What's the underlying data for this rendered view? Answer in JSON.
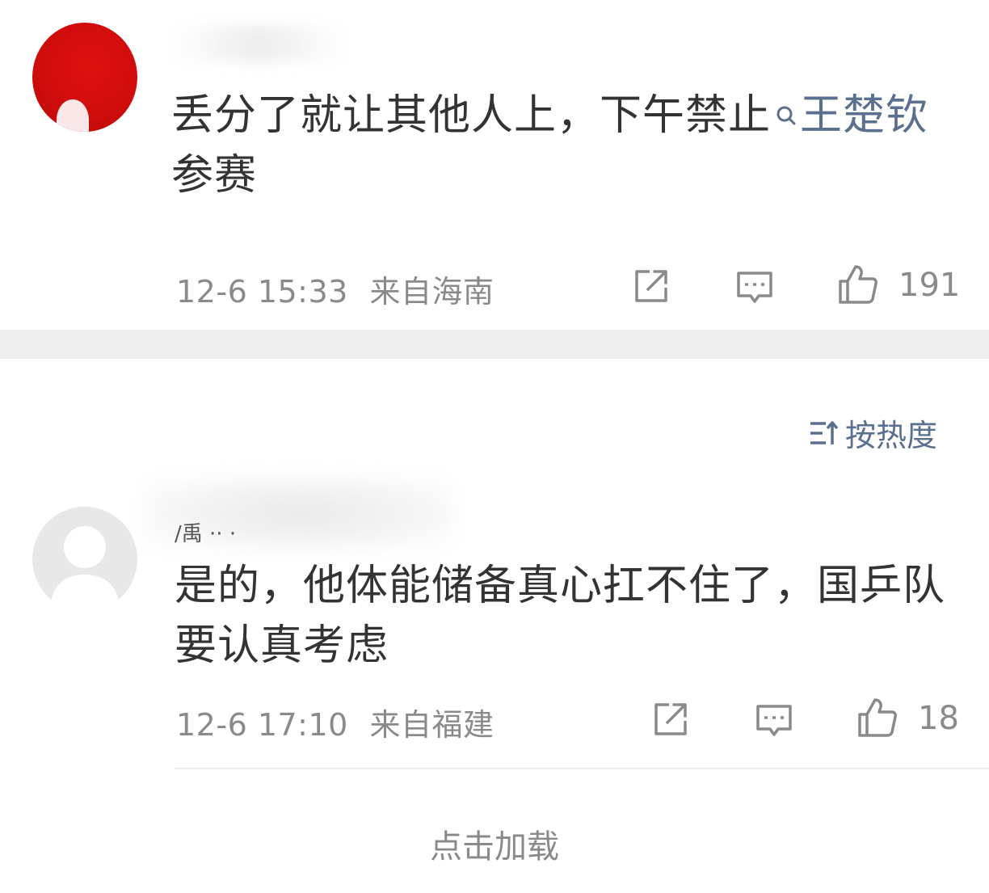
{
  "comments": [
    {
      "avatar": "red-petal-avatar",
      "text_before": "丢分了就让其他人上，下午禁止",
      "topic": "王楚钦",
      "text_after": " 参赛",
      "time": "12-6 15:33",
      "location": "来自海南",
      "likes": "191"
    },
    {
      "avatar": "default-gray-avatar",
      "username": "/禹 ·· ·",
      "text": "是的，他体能储备真心扛不住了，国乒队要认真考虑",
      "time": "12-6 17:10",
      "location": "来自福建",
      "likes": "18"
    }
  ],
  "sort": {
    "label": "按热度",
    "icon": "sort-icon"
  },
  "load_more": "点击加载",
  "icons": {
    "share": "share-icon",
    "comment": "comment-icon",
    "like": "thumbs-up-icon",
    "topic": "search-icon"
  },
  "colors": {
    "link": "#5b6f8e",
    "text": "#333333",
    "meta": "#8a8a8a",
    "band": "#efefef"
  }
}
